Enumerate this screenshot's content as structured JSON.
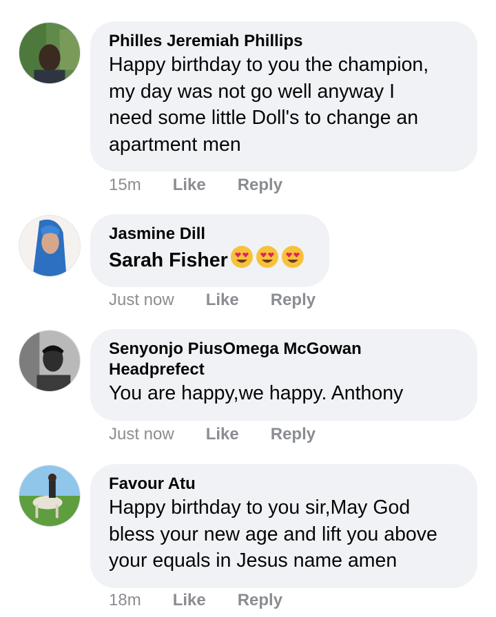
{
  "comments": [
    {
      "author": "Philles Jeremiah Phillips",
      "text": "Happy birthday to you the champion,\nmy day was not go well anyway I\nneed some little Doll's to change an\napartment men",
      "time": "15m",
      "like": "Like",
      "reply": "Reply",
      "avatar_icon": "profile-photo-man-green-background"
    },
    {
      "author": "Jasmine Dill",
      "text": "Sarah Fisher",
      "emojis": [
        "heart-eyes-emoji",
        "heart-eyes-emoji",
        "heart-eyes-emoji"
      ],
      "time": "Just now",
      "like": "Like",
      "reply": "Reply",
      "avatar_icon": "profile-photo-woman-blue-hair"
    },
    {
      "author": "Senyonjo PiusOmega McGowan\nHeadprefect",
      "text": "You are happy,we happy. Anthony",
      "time": "Just now",
      "like": "Like",
      "reply": "Reply",
      "avatar_icon": "profile-photo-man-grayscale"
    },
    {
      "author": "Favour Atu",
      "text": "Happy birthday to you sir,May God\nbless your new age and lift you above\nyour equals in Jesus name amen",
      "time": "18m",
      "like": "Like",
      "reply": "Reply",
      "avatar_icon": "profile-photo-horse-rider"
    }
  ],
  "colors": {
    "bubble": "#f0f2f5",
    "text": "#050505",
    "meta": "#8a8d91"
  }
}
